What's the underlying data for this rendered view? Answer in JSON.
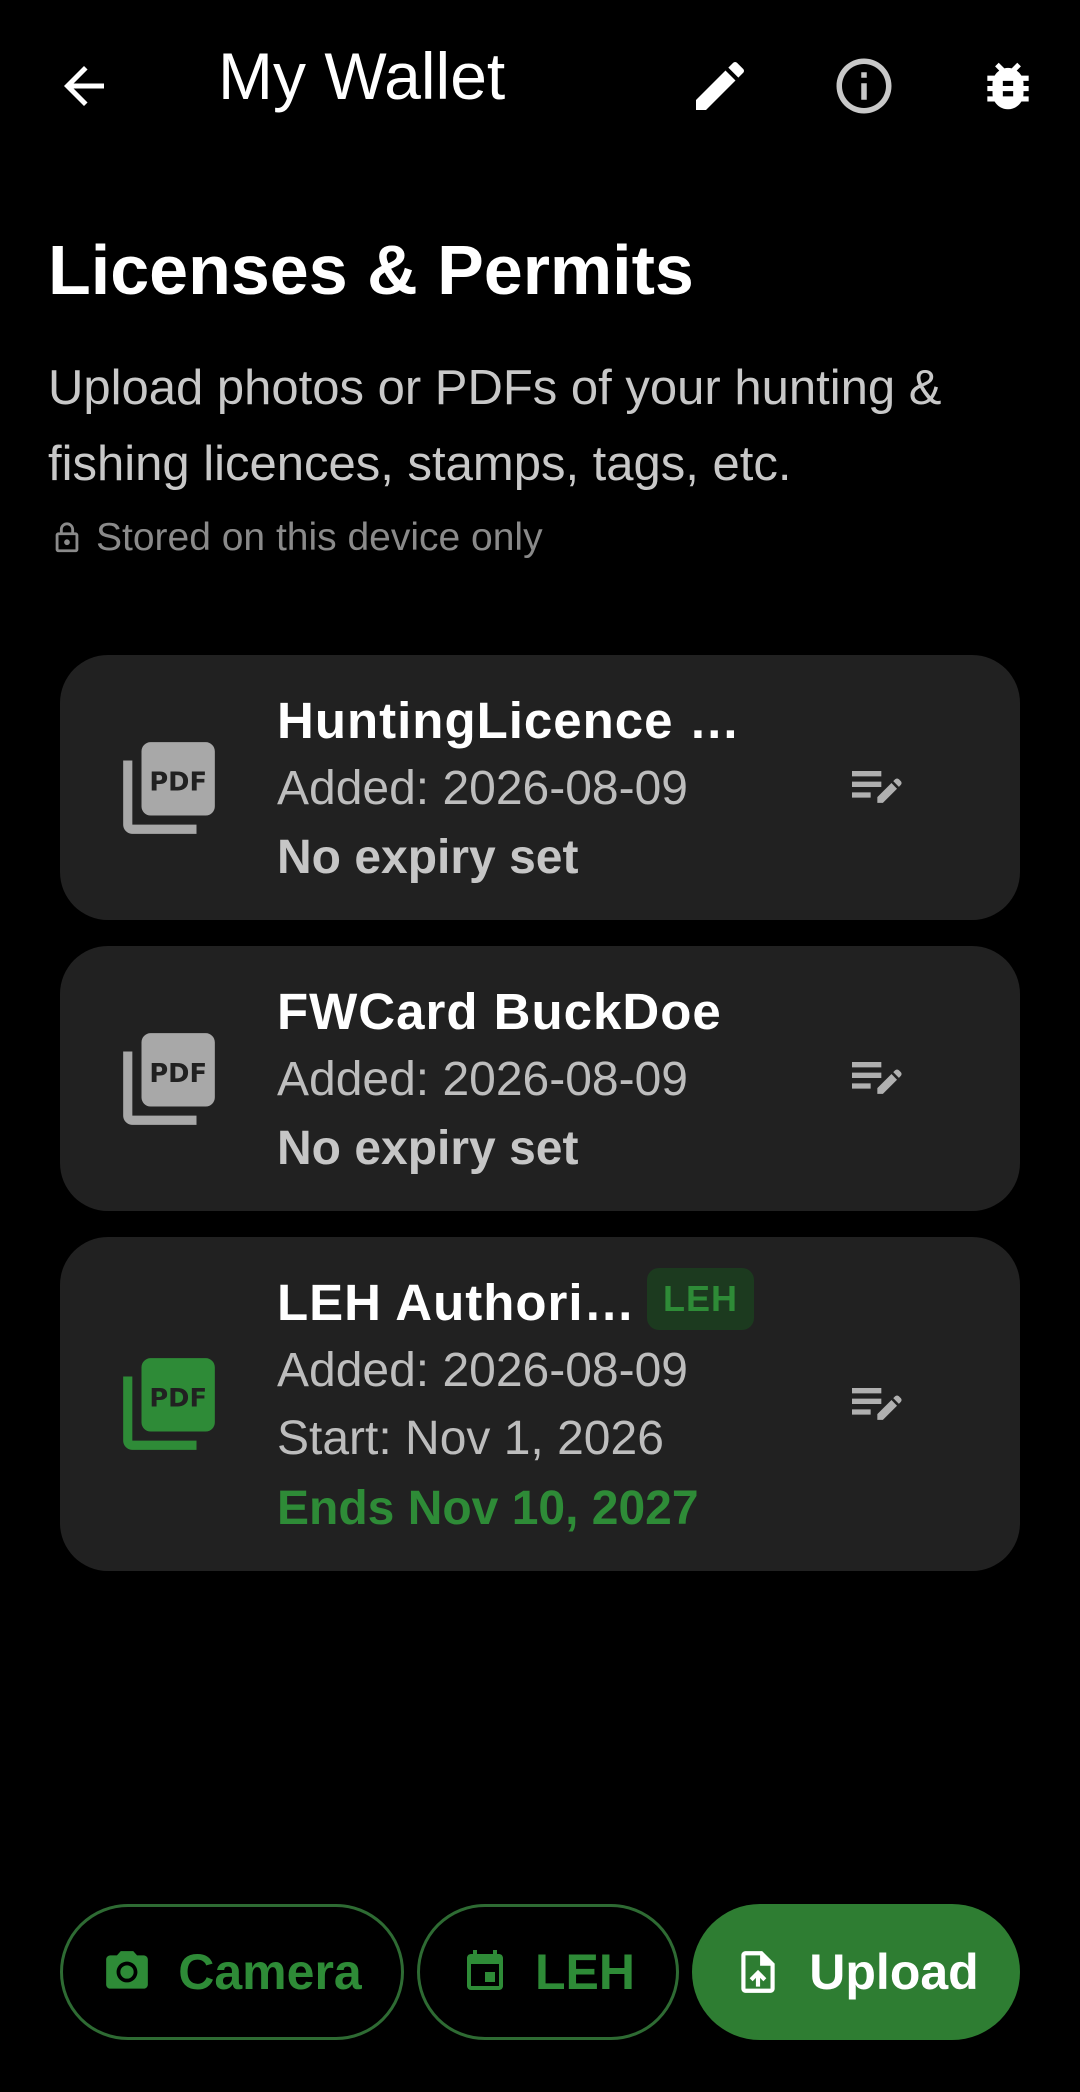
{
  "app_bar": {
    "title": "My Wallet",
    "back_icon": "arrow-back-icon",
    "edit_icon": "pencil-icon",
    "info_icon": "info-icon",
    "debug_icon": "bug-icon"
  },
  "section": {
    "heading": "Licenses & Permits",
    "description": "Upload photos or PDFs of your hunting & fishing licences, stamps, tags, etc.",
    "storage_note": "Stored on this device only"
  },
  "documents": [
    {
      "name": "HuntingLicence …",
      "added": "Added: 2026-08-09",
      "detail": "No expiry set",
      "icon_color": "#a8a8a8"
    },
    {
      "name": "FWCard BuckDoe",
      "added": "Added: 2026-08-09",
      "detail": "No expiry set",
      "icon_color": "#a8a8a8"
    },
    {
      "name": "LEH Authori…",
      "badge": "LEH",
      "added": "Added: 2026-08-09",
      "start": "Start: Nov 1, 2026",
      "ends": "Ends Nov 10, 2027",
      "icon_color": "#2e8b37"
    }
  ],
  "actions": {
    "camera": "Camera",
    "leh": "LEH",
    "upload": "Upload"
  },
  "colors": {
    "accent": "#2e7d32",
    "accent_text": "#2e8b37",
    "card_bg": "#212121"
  }
}
